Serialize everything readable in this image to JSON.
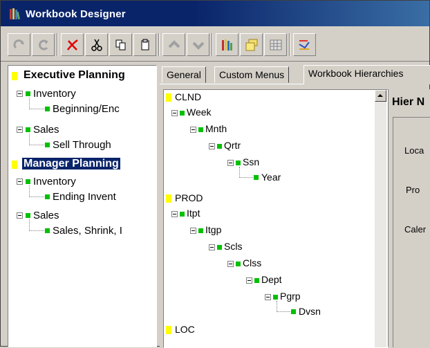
{
  "window": {
    "title": "Workbook Designer"
  },
  "toolbar": {
    "buttons": [
      {
        "name": "redo-button",
        "icon": "redo-icon"
      },
      {
        "name": "refresh-button",
        "icon": "refresh-icon"
      },
      {
        "name": "delete-button",
        "icon": "delete-x-icon"
      },
      {
        "name": "cut-button",
        "icon": "scissors-icon"
      },
      {
        "name": "copy-button",
        "icon": "copy-icon"
      },
      {
        "name": "paste-button",
        "icon": "paste-icon"
      },
      {
        "name": "move-up-button",
        "icon": "chevron-up-icon"
      },
      {
        "name": "move-down-button",
        "icon": "chevron-down-icon"
      },
      {
        "name": "workbook-library-button",
        "icon": "books-icon"
      },
      {
        "name": "folders-button",
        "icon": "folders-icon"
      },
      {
        "name": "grid-button",
        "icon": "grid-icon"
      },
      {
        "name": "chart-tools-button",
        "icon": "chart-tools-icon"
      }
    ]
  },
  "left_tree": {
    "items": [
      {
        "label": "Executive Planning",
        "level": 0,
        "bold": true,
        "selected": false
      },
      {
        "label": "Inventory",
        "level": 1
      },
      {
        "label": "Beginning/Enc",
        "level": 2
      },
      {
        "label": "Sales",
        "level": 1
      },
      {
        "label": "Sell Through",
        "level": 2
      },
      {
        "label": "Manager Planning",
        "level": 0,
        "bold": true,
        "selected": true
      },
      {
        "label": "Inventory",
        "level": 1
      },
      {
        "label": "Ending Invent",
        "level": 2
      },
      {
        "label": "Sales",
        "level": 1
      },
      {
        "label": "Sales, Shrink, I",
        "level": 2
      }
    ]
  },
  "tabs": [
    {
      "label": "General"
    },
    {
      "label": "Custom Menus"
    },
    {
      "label": "Workbook Hierarchies",
      "active": true
    }
  ],
  "hierarchy_tree": {
    "items": [
      {
        "label": "CLND",
        "level": 0,
        "root": true
      },
      {
        "label": "Week",
        "level": 1
      },
      {
        "label": "Mnth",
        "level": 2
      },
      {
        "label": "Qrtr",
        "level": 3
      },
      {
        "label": "Ssn",
        "level": 4
      },
      {
        "label": "Year",
        "level": 5
      },
      {
        "label": "PROD",
        "level": 0,
        "root": true
      },
      {
        "label": "Itpt",
        "level": 1
      },
      {
        "label": "Itgp",
        "level": 2
      },
      {
        "label": "Scls",
        "level": 3
      },
      {
        "label": "Clss",
        "level": 4
      },
      {
        "label": "Dept",
        "level": 5
      },
      {
        "label": "Pgrp",
        "level": 6
      },
      {
        "label": "Dvsn",
        "level": 7
      },
      {
        "label": "LOC",
        "level": 0,
        "root": true
      }
    ]
  },
  "detail": {
    "title": "Hier N",
    "labels": [
      "Loca",
      "Pro",
      "Caler"
    ]
  },
  "colors": {
    "title_bar": "#0a246a",
    "node_green": "#00c000",
    "root_yellow": "#ffff00",
    "selection": "#0a246a"
  }
}
